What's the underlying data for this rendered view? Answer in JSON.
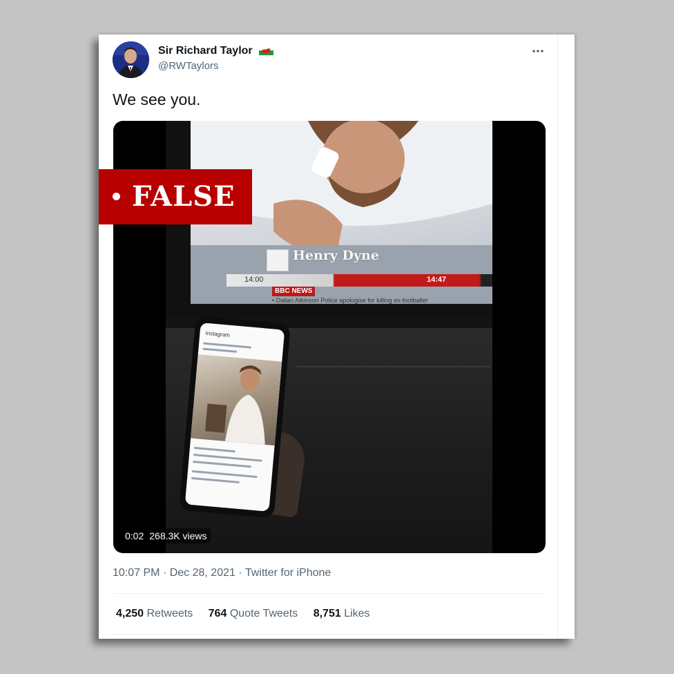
{
  "tweet": {
    "display_name": "Sir Richard Taylor",
    "handle": "@RWTaylors",
    "text": "We see you.",
    "timestamp": "10:07 PM · Dec 28, 2021 · ",
    "source": "Twitter for iPhone",
    "more_icon": "more-horizontal-icon",
    "flag_icon": "wales-flag-icon"
  },
  "video": {
    "time": "0:02",
    "views": "268.3K views",
    "tv": {
      "name": "Henry Dyne",
      "time_left": "14:00",
      "time_right": "14:47",
      "channel": "BBC NEWS",
      "ticker": "• Dalian Atkinson  Police apologise for killing ex-footballer"
    },
    "phone_app": "Instagram"
  },
  "fact_check": {
    "label": "FALSE",
    "color": "#b80000"
  },
  "stats": {
    "retweets_count": "4,250",
    "retweets_label": "Retweets",
    "quotes_count": "764",
    "quotes_label": "Quote Tweets",
    "likes_count": "8,751",
    "likes_label": "Likes"
  }
}
